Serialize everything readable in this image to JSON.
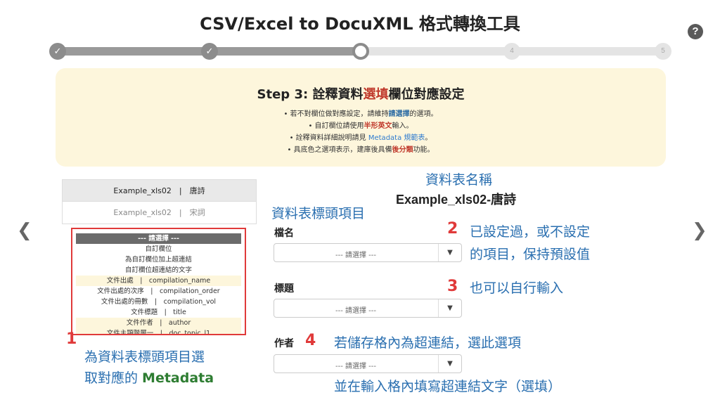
{
  "app": {
    "title": "CSV/Excel to DocuXML 格式轉換工具",
    "help_icon": "question-circle-icon"
  },
  "wizard": {
    "current_step": 3,
    "total_steps": 5,
    "step4_label": "4",
    "step5_label": "5",
    "done_mark": "✓"
  },
  "info": {
    "title_prefix": "Step 3: 詮釋資料",
    "title_highlight": "選填",
    "title_suffix": "欄位對應設定",
    "bullet1_a": "若不對欄位做對應設定，請維持",
    "bullet1_hl": "請選擇",
    "bullet1_b": "的選項。",
    "bullet2_a": "自訂欄位請使用",
    "bullet2_hl": "半形英文",
    "bullet2_b": "輸入。",
    "bullet3_a": "詮釋資料詳細說明請見 ",
    "bullet3_link": "Metadata 規範表",
    "bullet3_b": "。",
    "bullet4_a": "具底色之選項表示，建庫後具備",
    "bullet4_hl": "後分類",
    "bullet4_b": "功能。",
    "colors": {
      "highlight_blue": "#2e6da4",
      "highlight_red": "#c0392b",
      "box_bg": "#fdf6dc"
    }
  },
  "sheets": [
    {
      "label": "Example_xls02　|　唐詩",
      "active": true
    },
    {
      "label": "Example_xls02　|　宋詞",
      "active": false
    }
  ],
  "metadata_options": [
    {
      "label": "--- 請選擇 ---",
      "type": "header"
    },
    {
      "label": "自訂欄位",
      "type": "plain"
    },
    {
      "label": "為自訂欄位加上超連結",
      "type": "plain"
    },
    {
      "label": "自訂欄位超連結的文字",
      "type": "plain"
    },
    {
      "label": "文件出處　|　compilation_name",
      "type": "shaded"
    },
    {
      "label": "文件出處的次序　|　compilation_order",
      "type": "plain"
    },
    {
      "label": "文件出處的冊數　|　compilation_vol",
      "type": "plain"
    },
    {
      "label": "文件標題　|　title",
      "type": "plain"
    },
    {
      "label": "文件作者　|　author",
      "type": "shaded"
    },
    {
      "label": "文件主題階層一　|　doc_topic_l1",
      "type": "shaded"
    }
  ],
  "main": {
    "table_name_caption": "資料表名稱",
    "table_name": "Example_xls02-唐詩",
    "header_items_caption": "資料表標頭項目",
    "fields": [
      {
        "label": "檔名",
        "placeholder": "--- 請選擇 ---"
      },
      {
        "label": "標題",
        "placeholder": "--- 請選擇 ---"
      },
      {
        "label": "作者",
        "placeholder": "--- 請選擇 ---"
      }
    ],
    "caret": "▼"
  },
  "annotations": {
    "n1": "1",
    "a1_line1": "為資料表標頭項目選",
    "a1_line2_a": "取對應的 ",
    "a1_line2_b": "Metadata",
    "n2": "2",
    "a2_line1": "已設定過，或不設定",
    "a2_line2": "的項目，保持預設值",
    "n3": "3",
    "a3": "也可以自行輸入",
    "n4": "4",
    "a4_line1": "若儲存格內為超連結，選此選項",
    "a4_line2": "並在輸入格內填寫超連結文字（選填）"
  },
  "nav": {
    "prev": "❮",
    "next": "❯"
  }
}
